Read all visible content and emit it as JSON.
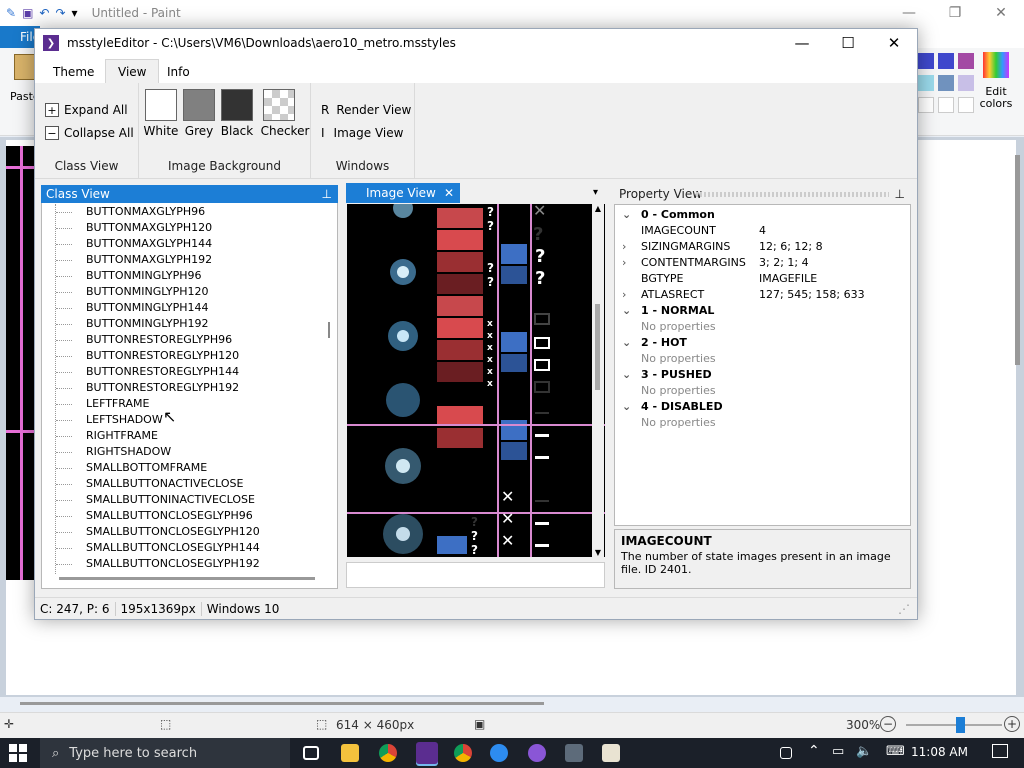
{
  "paint": {
    "title": "Untitled - Paint",
    "file_tab": "File",
    "paste_label": "Paste",
    "edit_colors": "Edit colors",
    "size_label": "614 × 460px",
    "zoom": "300%"
  },
  "window": {
    "title": "msstyleEditor - C:\\Users\\VM6\\Downloads\\aero10_metro.msstyles",
    "tabs": [
      "Theme",
      "View",
      "Info"
    ],
    "active_tab": "View"
  },
  "ribbon": {
    "class_view": {
      "expand": "Expand All",
      "collapse": "Collapse All",
      "label": "Class View"
    },
    "image_background": {
      "options": [
        "White",
        "Grey",
        "Black",
        "Checker"
      ],
      "label": "Image Background"
    },
    "windows": {
      "render": "Render View",
      "image": "Image View",
      "label": "Windows"
    }
  },
  "class_view": {
    "title": "Class View",
    "items": [
      "BUTTONMAXGLYPH96",
      "BUTTONMAXGLYPH120",
      "BUTTONMAXGLYPH144",
      "BUTTONMAXGLYPH192",
      "BUTTONMINGLYPH96",
      "BUTTONMINGLYPH120",
      "BUTTONMINGLYPH144",
      "BUTTONMINGLYPH192",
      "BUTTONRESTOREGLYPH96",
      "BUTTONRESTOREGLYPH120",
      "BUTTONRESTOREGLYPH144",
      "BUTTONRESTOREGLYPH192",
      "LEFTFRAME",
      "LEFTSHADOW",
      "RIGHTFRAME",
      "RIGHTSHADOW",
      "SMALLBOTTOMFRAME",
      "SMALLBUTTONACTIVECLOSE",
      "SMALLBUTTONINACTIVECLOSE",
      "SMALLBUTTONCLOSEGLYPH96",
      "SMALLBUTTONCLOSEGLYPH120",
      "SMALLBUTTONCLOSEGLYPH144",
      "SMALLBUTTONCLOSEGLYPH192"
    ]
  },
  "image_view": {
    "title": "Image View"
  },
  "property_view": {
    "title": "Property View",
    "rows": [
      {
        "type": "cat",
        "key": "0 - Common"
      },
      {
        "type": "prop",
        "key": "IMAGECOUNT",
        "value": "4"
      },
      {
        "type": "prop",
        "key": "SIZINGMARGINS",
        "value": "12; 6; 12; 8",
        "expandable": true
      },
      {
        "type": "prop",
        "key": "CONTENTMARGINS",
        "value": "3; 2; 1; 4",
        "expandable": true
      },
      {
        "type": "prop",
        "key": "BGTYPE",
        "value": "IMAGEFILE"
      },
      {
        "type": "prop",
        "key": "ATLASRECT",
        "value": "127; 545; 158; 633",
        "expandable": true
      },
      {
        "type": "cat",
        "key": "1 - NORMAL"
      },
      {
        "type": "np",
        "key": "No properties"
      },
      {
        "type": "cat",
        "key": "2 - HOT"
      },
      {
        "type": "np",
        "key": "No properties"
      },
      {
        "type": "cat",
        "key": "3 - PUSHED"
      },
      {
        "type": "np",
        "key": "No properties"
      },
      {
        "type": "cat",
        "key": "4 - DISABLED"
      },
      {
        "type": "np",
        "key": "No properties"
      }
    ],
    "desc_title": "IMAGECOUNT",
    "desc_body": "The number of state images present in an image file. ID 2401."
  },
  "status": {
    "coords": "C: 247, P: 6",
    "size": "195x1369px",
    "os": "Windows 10"
  },
  "taskbar": {
    "search": "Type here to search",
    "time": "11:08 AM"
  },
  "colors": {
    "accent": "#1c7ed6",
    "title_icon": "#5b2d90"
  }
}
